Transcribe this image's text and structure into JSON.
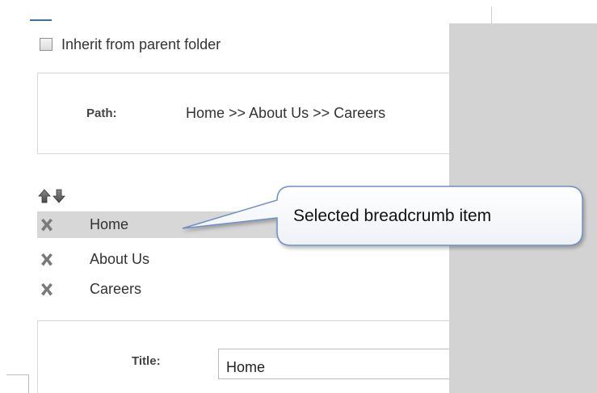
{
  "inherit": {
    "label": "Inherit from parent folder",
    "checked": false
  },
  "path": {
    "label": "Path:",
    "value": "Home >> About Us >> Careers"
  },
  "arrows": {
    "up_icon": "arrow-up-icon",
    "down_icon": "arrow-down-icon"
  },
  "breadcrumbs": {
    "remove_icon": "remove-x-icon",
    "items": [
      {
        "label": "Home",
        "selected": true
      },
      {
        "label": "About Us",
        "selected": false
      },
      {
        "label": "Careers",
        "selected": false
      }
    ]
  },
  "title_field": {
    "label": "Title:",
    "value": "Home"
  },
  "callout": {
    "text": "Selected breadcrumb item",
    "border_color": "#6f8fc4"
  },
  "colors": {
    "selected_row": "#d7d7d7",
    "overlay": "#d3d3d3"
  }
}
